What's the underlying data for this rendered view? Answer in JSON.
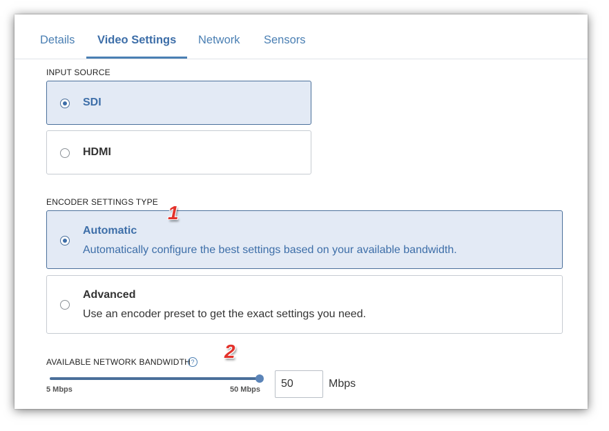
{
  "tabs": [
    {
      "label": "Details"
    },
    {
      "label": "Video Settings"
    },
    {
      "label": "Network"
    },
    {
      "label": "Sensors"
    }
  ],
  "active_tab": "Video Settings",
  "input_source": {
    "label": "INPUT SOURCE",
    "options": [
      {
        "title": "SDI",
        "selected": true
      },
      {
        "title": "HDMI",
        "selected": false
      }
    ]
  },
  "encoder": {
    "label": "ENCODER SETTINGS TYPE",
    "options": [
      {
        "title": "Automatic",
        "description": "Automatically configure the best settings based on your available bandwidth.",
        "selected": true
      },
      {
        "title": "Advanced",
        "description": "Use an encoder preset to get the exact settings you need.",
        "selected": false
      }
    ]
  },
  "bandwidth": {
    "label": "AVAILABLE NETWORK BANDWIDTH",
    "help_icon": "question-circle-icon",
    "min_label": "5 Mbps",
    "max_label": "50 Mbps",
    "value": "50",
    "unit": "Mbps",
    "slider_fraction": 1.0
  },
  "annotations": [
    "1",
    "2"
  ],
  "colors": {
    "accent": "#4a7fb3",
    "selected_bg": "#e3eaf5",
    "marker": "#e3322b"
  }
}
